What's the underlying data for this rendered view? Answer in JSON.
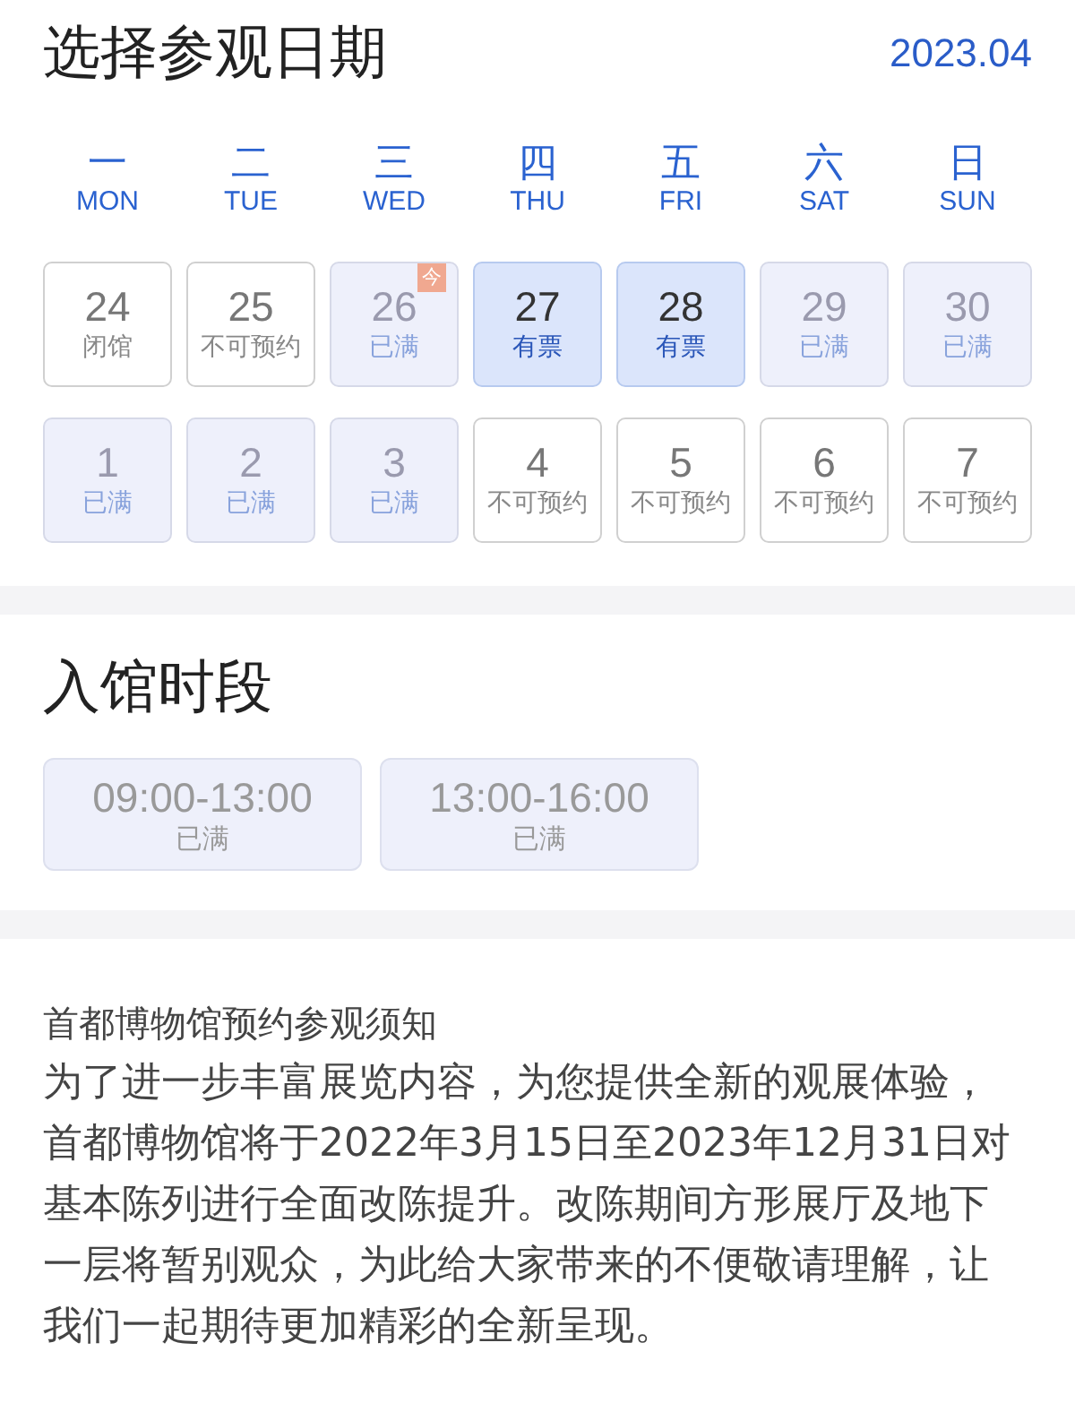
{
  "header": {
    "title": "选择参观日期",
    "month": "2023.04"
  },
  "weekdays": [
    {
      "zh": "一",
      "en": "MON"
    },
    {
      "zh": "二",
      "en": "TUE"
    },
    {
      "zh": "三",
      "en": "WED"
    },
    {
      "zh": "四",
      "en": "THU"
    },
    {
      "zh": "五",
      "en": "FRI"
    },
    {
      "zh": "六",
      "en": "SAT"
    },
    {
      "zh": "日",
      "en": "SUN"
    }
  ],
  "weeks": [
    [
      {
        "day": "24",
        "status": "闭馆",
        "kind": "closed"
      },
      {
        "day": "25",
        "status": "不可预约",
        "kind": "unavailable"
      },
      {
        "day": "26",
        "status": "已满",
        "kind": "full",
        "badge": "今"
      },
      {
        "day": "27",
        "status": "有票",
        "kind": "available"
      },
      {
        "day": "28",
        "status": "有票",
        "kind": "available"
      },
      {
        "day": "29",
        "status": "已满",
        "kind": "full"
      },
      {
        "day": "30",
        "status": "已满",
        "kind": "full"
      }
    ],
    [
      {
        "day": "1",
        "status": "已满",
        "kind": "full"
      },
      {
        "day": "2",
        "status": "已满",
        "kind": "full"
      },
      {
        "day": "3",
        "status": "已满",
        "kind": "full"
      },
      {
        "day": "4",
        "status": "不可预约",
        "kind": "unavailable"
      },
      {
        "day": "5",
        "status": "不可预约",
        "kind": "unavailable"
      },
      {
        "day": "6",
        "status": "不可预约",
        "kind": "unavailable"
      },
      {
        "day": "7",
        "status": "不可预约",
        "kind": "unavailable"
      }
    ]
  ],
  "slots_section": {
    "title": "入馆时段",
    "slots": [
      {
        "time": "09:00-13:00",
        "status": "已满",
        "kind": "full"
      },
      {
        "time": "13:00-16:00",
        "status": "已满",
        "kind": "full"
      }
    ]
  },
  "notice": {
    "title": "首都博物馆预约参观须知",
    "body": "为了进一步丰富展览内容，为您提供全新的观展体验，首都博物馆将于2022年3月15日至2023年12月31日对基本陈列进行全面改陈提升。改陈期间方形展厅及地下一层将暂别观众，为此给大家带来的不便敬请理解，让我们一起期待更加精彩的全新呈现。"
  }
}
